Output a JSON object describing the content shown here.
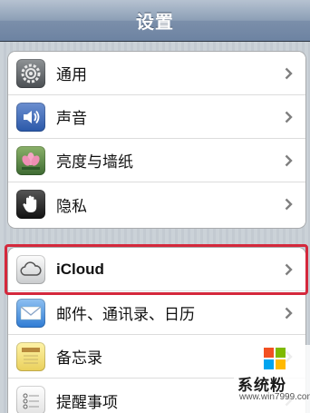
{
  "navbar": {
    "title": "设置"
  },
  "group1": [
    {
      "label": "通用",
      "icon": "gear-icon"
    },
    {
      "label": "声音",
      "icon": "speaker-icon"
    },
    {
      "label": "亮度与墙纸",
      "icon": "flower-icon"
    },
    {
      "label": "隐私",
      "icon": "hand-icon"
    }
  ],
  "group2": [
    {
      "label": "iCloud",
      "icon": "cloud-icon"
    },
    {
      "label": "邮件、通讯录、日历",
      "icon": "mail-icon"
    },
    {
      "label": "备忘录",
      "icon": "notes-icon"
    },
    {
      "label": "提醒事项",
      "icon": "checklist-icon"
    }
  ],
  "colors": {
    "highlight": "#d4283c",
    "navbar": "#7b8faa"
  },
  "watermark": {
    "name": "系统粉",
    "url": "www.win7999.com"
  }
}
